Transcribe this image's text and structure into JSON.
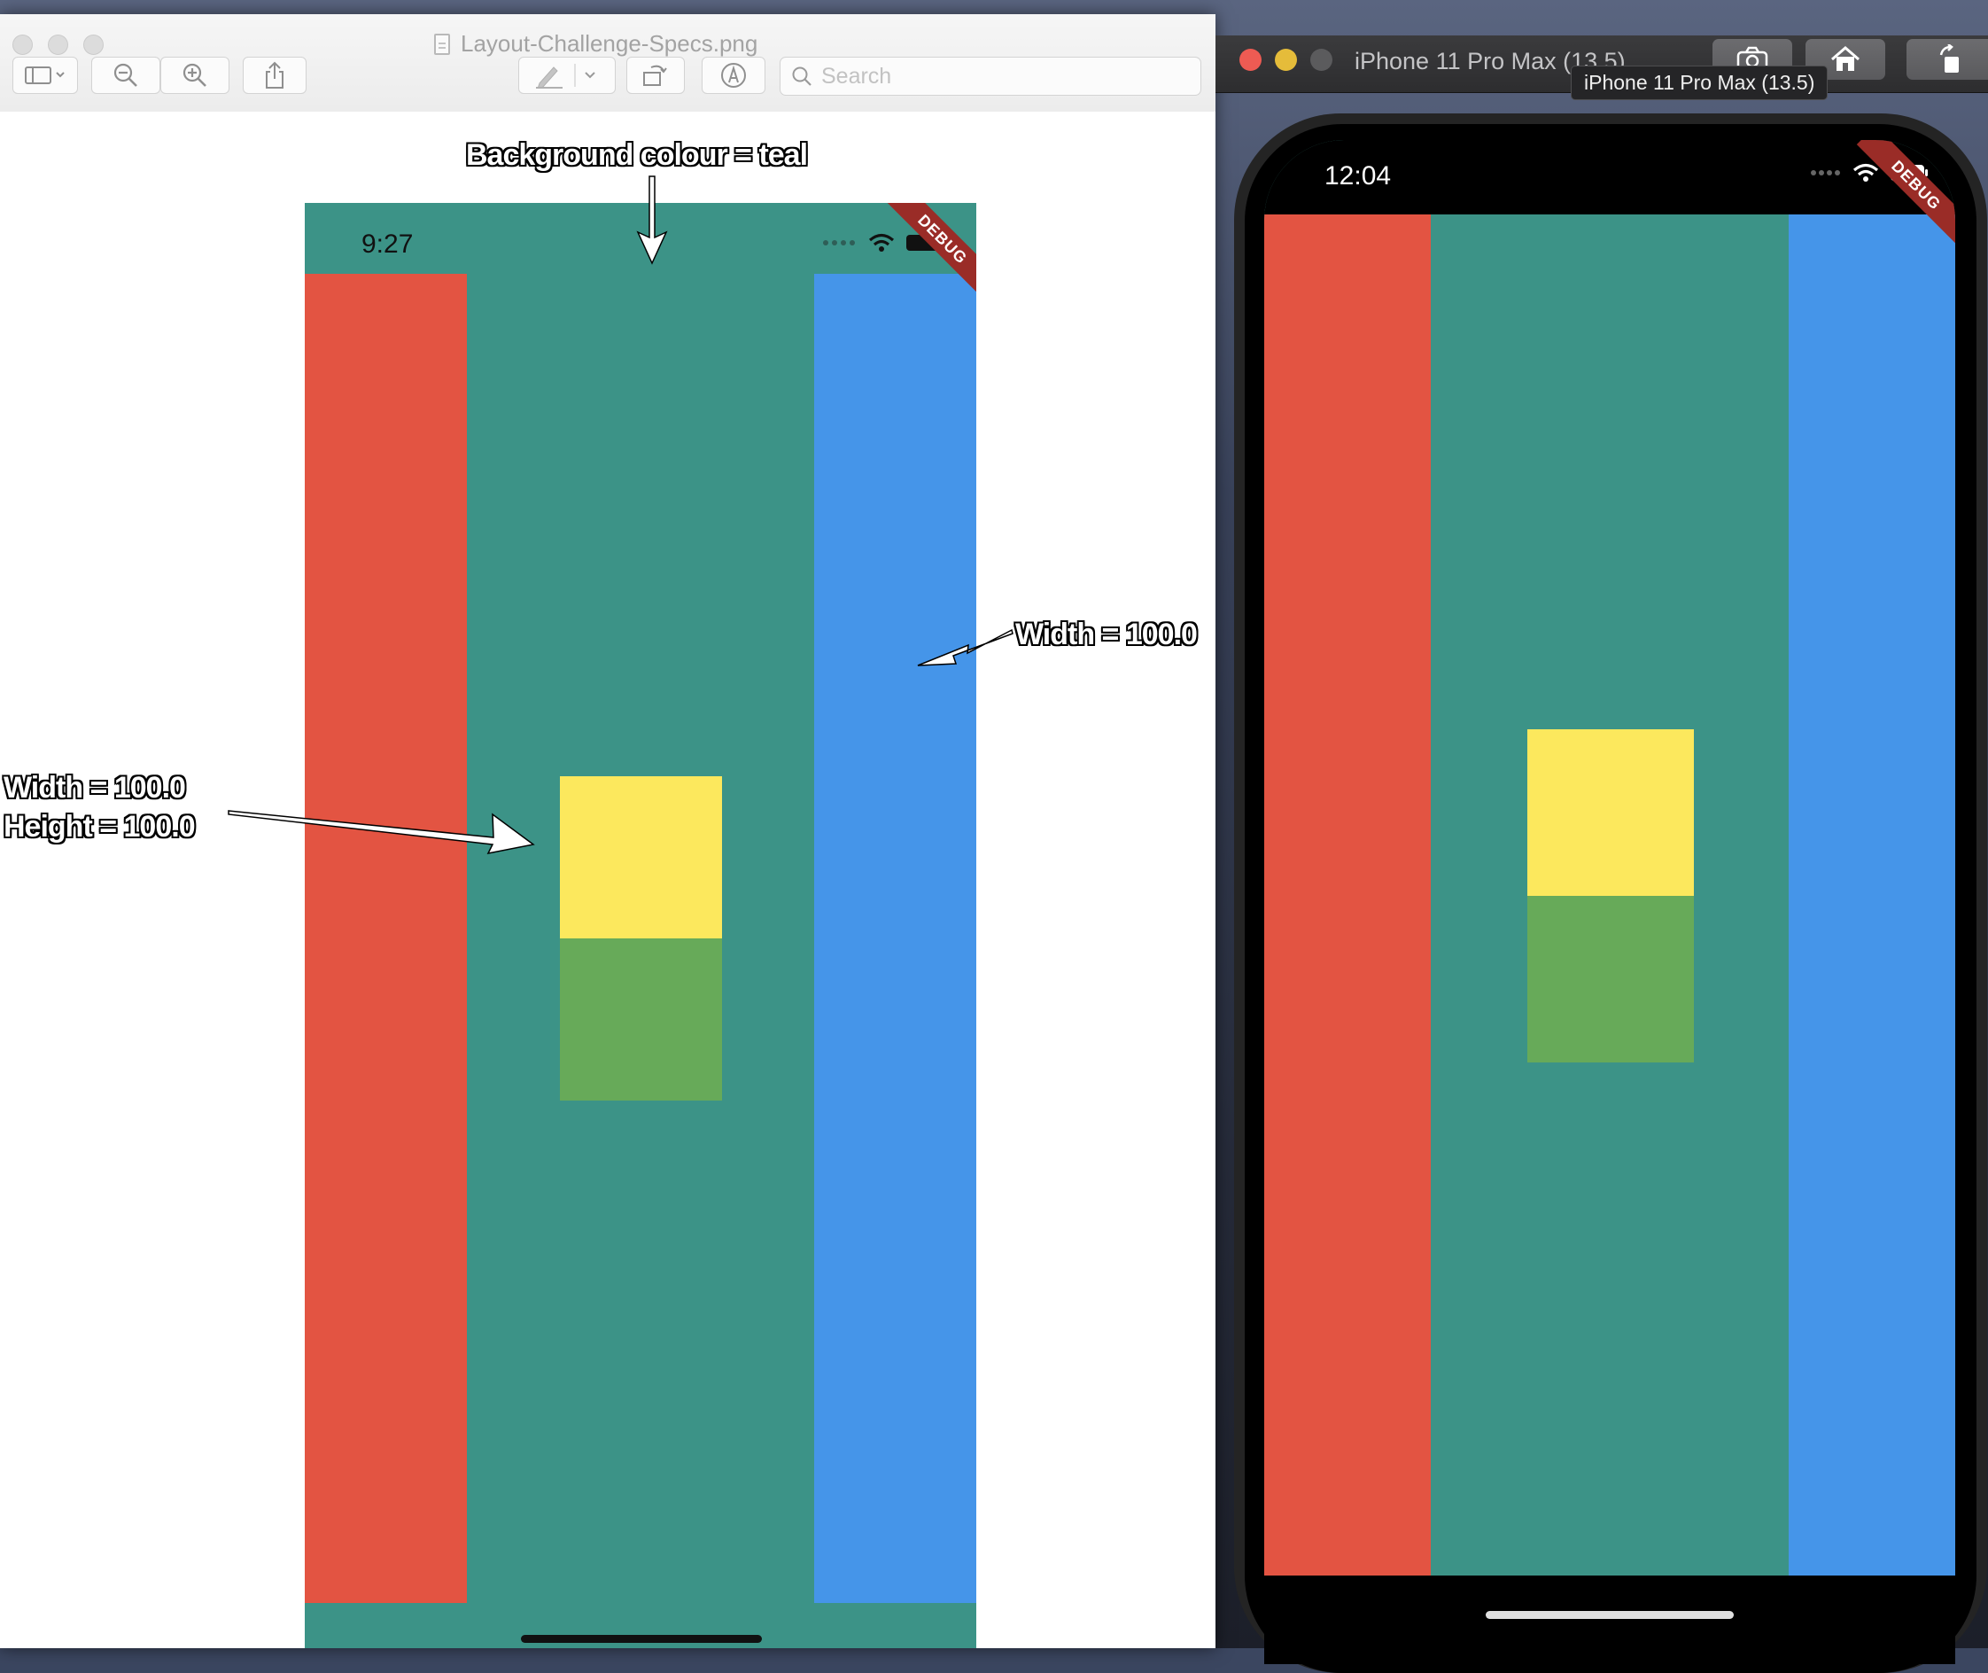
{
  "preview": {
    "window_title": "Layout-Challenge-Specs.png",
    "search_placeholder": "Search",
    "mockup": {
      "status_time": "9:27",
      "debug_ribbon": "DEBUG"
    },
    "annotations": {
      "background": "Background colour = teal",
      "right_column": "Width = 100.0",
      "center_box": "Width = 100.0\nHeight = 100.0"
    }
  },
  "simulator": {
    "window_title": "iPhone 11 Pro Max (13.5)",
    "tooltip": "iPhone 11 Pro Max (13.5)",
    "status_time": "12:04",
    "debug_ribbon": "DEBUG"
  },
  "colors": {
    "teal": "#3c9387",
    "red": "#e35442",
    "blue": "#4595e9",
    "yellow": "#fce85d",
    "green": "#67aa59",
    "debug_ribbon": "#9a2c27"
  },
  "icons": {
    "toolbar": [
      "sidebar-icon",
      "zoom-out-icon",
      "zoom-in-icon",
      "share-icon",
      "markup-icon",
      "rotate-icon",
      "annotate-icon",
      "search-icon"
    ],
    "simulator": [
      "screenshot-icon",
      "home-icon",
      "rotate-icon"
    ]
  }
}
